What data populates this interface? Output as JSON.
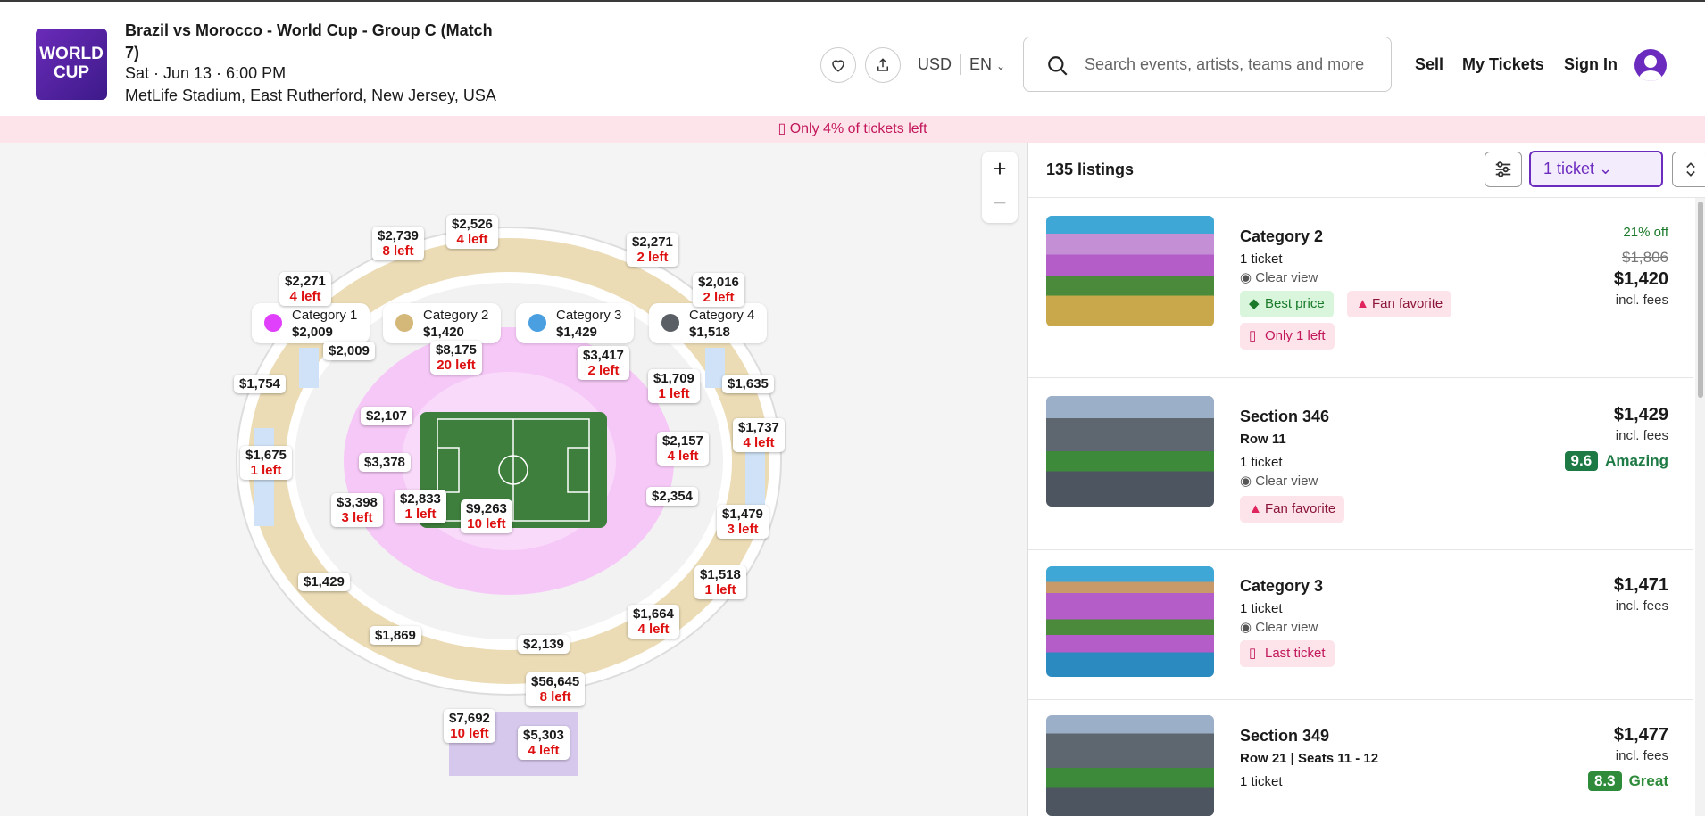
{
  "event": {
    "logo_text": "WORLD CUP",
    "title": "Brazil vs Morocco - World Cup - Group C (Match 7)",
    "date": "Sat · Jun 13 · 6:00 PM",
    "venue": "MetLife Stadium, East Rutherford, New Jersey, USA"
  },
  "header": {
    "currency": "USD",
    "language": "EN",
    "search_placeholder": "Search events, artists, teams and more",
    "sell": "Sell",
    "my_tickets": "My Tickets",
    "sign_in": "Sign In"
  },
  "banner": "Only 4% of tickets left",
  "legend": [
    {
      "name": "Category 1",
      "price": "$2,009",
      "color": "#e040fb"
    },
    {
      "name": "Category 2",
      "price": "$1,420",
      "color": "#d4b87a"
    },
    {
      "name": "Category 3",
      "price": "$1,429",
      "color": "#4a9fe0"
    },
    {
      "name": "Category 4",
      "price": "$1,518",
      "color": "#5a5f66"
    }
  ],
  "zoom": {
    "in": "+",
    "out": "−"
  },
  "map_pins": [
    {
      "price": "$2,739",
      "left": "8 left"
    },
    {
      "price": "$2,526",
      "left": "4 left"
    },
    {
      "price": "$2,271",
      "left": "2 left"
    },
    {
      "price": "$2,271",
      "left": "4 left"
    },
    {
      "price": "$2,016",
      "left": "2 left"
    },
    {
      "price": "$2,009",
      "left": ""
    },
    {
      "price": "$8,175",
      "left": "20 left"
    },
    {
      "price": "$3,417",
      "left": "2 left"
    },
    {
      "price": "$1,754",
      "left": ""
    },
    {
      "price": "$1,709",
      "left": "1 left"
    },
    {
      "price": "$1,635",
      "left": ""
    },
    {
      "price": "$2,107",
      "left": ""
    },
    {
      "price": "$1,737",
      "left": "4 left"
    },
    {
      "price": "$1,675",
      "left": "1 left"
    },
    {
      "price": "$2,157",
      "left": "4 left"
    },
    {
      "price": "$3,378",
      "left": ""
    },
    {
      "price": "$2,354",
      "left": ""
    },
    {
      "price": "$3,398",
      "left": "3 left"
    },
    {
      "price": "$2,833",
      "left": "1 left"
    },
    {
      "price": "$9,263",
      "left": "10 left"
    },
    {
      "price": "$1,479",
      "left": "3 left"
    },
    {
      "price": "$1,518",
      "left": "1 left"
    },
    {
      "price": "$1,429",
      "left": ""
    },
    {
      "price": "$1,664",
      "left": "4 left"
    },
    {
      "price": "$1,869",
      "left": ""
    },
    {
      "price": "$2,139",
      "left": ""
    },
    {
      "price": "$56,645",
      "left": "8 left"
    },
    {
      "price": "$7,692",
      "left": "10 left"
    },
    {
      "price": "$5,303",
      "left": "4 left"
    }
  ],
  "listings": {
    "count": "135 listings",
    "ticket_filter": "1 ticket",
    "items": [
      {
        "title": "Category 2",
        "row": "",
        "qty": "1 ticket",
        "view": "Clear view",
        "discount": "21% off",
        "old_price": "$1,806",
        "price": "$1,420",
        "fees": "incl. fees",
        "tags": [
          "Best price",
          "Fan favorite",
          "Only 1 left"
        ]
      },
      {
        "title": "Section 346",
        "row": "Row 11",
        "qty": "1 ticket",
        "view": "Clear view",
        "price": "$1,429",
        "fees": "incl. fees",
        "score": "9.6",
        "score_label": "Amazing",
        "tags": [
          "Fan favorite"
        ]
      },
      {
        "title": "Category 3",
        "row": "",
        "qty": "1 ticket",
        "view": "Clear view",
        "price": "$1,471",
        "fees": "incl. fees",
        "tags": [
          "Last ticket"
        ]
      },
      {
        "title": "Section 349",
        "row": "Row 21 | Seats 11 - 12",
        "qty": "1 ticket",
        "price": "$1,477",
        "fees": "incl. fees",
        "score": "8.3",
        "score_label": "Great"
      }
    ]
  }
}
